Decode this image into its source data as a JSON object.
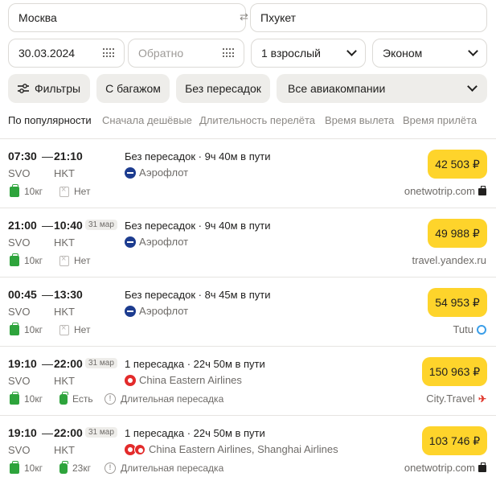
{
  "search": {
    "from": "Москва",
    "to": "Пхукет",
    "date": "30.03.2024",
    "return_placeholder": "Обратно",
    "passengers": "1 взрослый",
    "class": "Эконом"
  },
  "filters": {
    "filters_label": "Фильтры",
    "baggage_label": "С багажом",
    "nonstop_label": "Без пересадок",
    "airlines_label": "Все авиакомпании"
  },
  "sort": {
    "popular": "По популярности",
    "cheapest": "Сначала дешёвые",
    "duration": "Длительность перелёта",
    "departure": "Время вылета",
    "arrival": "Время прилёта"
  },
  "flights": [
    {
      "dep": "07:30",
      "arr": "21:10",
      "next_day": "",
      "from": "SVO",
      "to": "HKT",
      "info": "Без пересадок · 9ч 40м в пути",
      "airline": "Аэрофлот",
      "hand": "10кг",
      "bag": "Нет",
      "note": "",
      "price": "42 503 ₽",
      "agent": "onetwotrip.com"
    },
    {
      "dep": "21:00",
      "arr": "10:40",
      "next_day": "31 мар",
      "from": "SVO",
      "to": "HKT",
      "info": "Без пересадок · 9ч 40м в пути",
      "airline": "Аэрофлот",
      "hand": "10кг",
      "bag": "Нет",
      "note": "",
      "price": "49 988 ₽",
      "agent": "travel.yandex.ru"
    },
    {
      "dep": "00:45",
      "arr": "13:30",
      "next_day": "",
      "from": "SVO",
      "to": "HKT",
      "info": "Без пересадок · 8ч 45м в пути",
      "airline": "Аэрофлот",
      "hand": "10кг",
      "bag": "Нет",
      "note": "",
      "price": "54 953 ₽",
      "agent": "Tutu"
    },
    {
      "dep": "19:10",
      "arr": "22:00",
      "next_day": "31 мар",
      "from": "SVO",
      "to": "HKT",
      "info": "1 пересадка · 22ч 50м в пути",
      "airline": "China Eastern Airlines",
      "hand": "10кг",
      "bag": "Есть",
      "note": "Длительная пересадка",
      "price": "150 963 ₽",
      "agent": "City.Travel"
    },
    {
      "dep": "19:10",
      "arr": "22:00",
      "next_day": "31 мар",
      "from": "SVO",
      "to": "HKT",
      "info": "1 пересадка · 22ч 50м в пути",
      "airline": "China Eastern Airlines, Shanghai Airlines",
      "hand": "10кг",
      "bag": "23кг",
      "note": "Длительная пересадка",
      "price": "103 746 ₽",
      "agent": "onetwotrip.com"
    }
  ],
  "colors": {
    "accent": "#fed42b",
    "green": "#2ea43c",
    "border": "#dcdad6"
  }
}
